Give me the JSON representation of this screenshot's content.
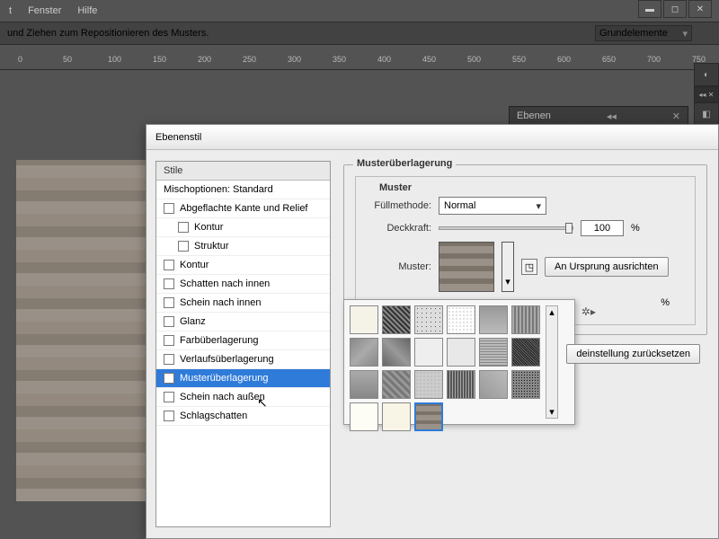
{
  "menu": {
    "window": "Fenster",
    "help": "Hilfe"
  },
  "info_bar": "und Ziehen zum Repositionieren des Musters.",
  "preset": "Grundelemente",
  "panel_tab": "Ebenen",
  "ruler_ticks": [
    "0",
    "50",
    "100",
    "150",
    "200",
    "250",
    "300",
    "350",
    "400",
    "450",
    "500",
    "550",
    "600",
    "650",
    "700",
    "750"
  ],
  "dialog": {
    "title": "Ebenenstil",
    "styles_header": "Stile",
    "items": [
      {
        "label": "Mischoptionen: Standard",
        "checked": null
      },
      {
        "label": "Abgeflachte Kante und Relief",
        "checked": false
      },
      {
        "label": "Kontur",
        "checked": false,
        "sub": true
      },
      {
        "label": "Struktur",
        "checked": false,
        "sub": true
      },
      {
        "label": "Kontur",
        "checked": false
      },
      {
        "label": "Schatten nach innen",
        "checked": false
      },
      {
        "label": "Schein nach innen",
        "checked": false
      },
      {
        "label": "Glanz",
        "checked": false
      },
      {
        "label": "Farbüberlagerung",
        "checked": false
      },
      {
        "label": "Verlaufsüberlagerung",
        "checked": false
      },
      {
        "label": "Musterüberlagerung",
        "checked": true,
        "selected": true
      },
      {
        "label": "Schein nach außen",
        "checked": false
      },
      {
        "label": "Schlagschatten",
        "checked": false
      }
    ],
    "section_title": "Musterüberlagerung",
    "subsection": "Muster",
    "fill_method_label": "Füllmethode:",
    "fill_method_value": "Normal",
    "opacity_label": "Deckkraft:",
    "opacity_value": "100",
    "percent": "%",
    "pattern_label": "Muster:",
    "snap_origin": "An Ursprung ausrichten",
    "reset": "deinstellung zurücksetzen"
  },
  "swatch_styles": [
    "#f5f2e8",
    "repeating-linear-gradient(45deg,#333 0 2px,#888 2px 4px)",
    "radial-gradient(#555 10%,transparent 11%) 0 0/5px 5px,#ddd",
    "radial-gradient(#888 20%,transparent 21%) 0 0/4px 4px,#fff",
    "linear-gradient(#999,#bbb)",
    "repeating-linear-gradient(90deg,#aaa 0 2px,#777 2px 4px)",
    "linear-gradient(135deg,#888,#aaa,#888)",
    "linear-gradient(45deg,#666,#999,#666)",
    "radial-gradient(#333 15%,transparent 16%) 0 0/3px 3px,#eee",
    "#e8e8e8",
    "repeating-linear-gradient(0deg,#888 0 1px,#bbb 1px 3px)",
    "repeating-linear-gradient(45deg,#222 0 1px,#666 1px 2px)",
    "linear-gradient(#aaa,#888)",
    "repeating-linear-gradient(45deg,#777 0 3px,#999 3px 6px)",
    "radial-gradient(#999 20%,transparent 21%) 0 0/4px 4px,#ccc",
    "repeating-linear-gradient(90deg,#555 0 2px,#aaa 2px 3px)",
    "linear-gradient(45deg,#999,#bbb)",
    "radial-gradient(#111 25%,transparent 26%) 0 0/3px 3px,#888",
    "#fdfdf5",
    "#f8f5e6",
    "repeating-linear-gradient(0deg,#9a9288 0 6px,#7b7268 6px 10px)"
  ],
  "selected_swatch": 20
}
